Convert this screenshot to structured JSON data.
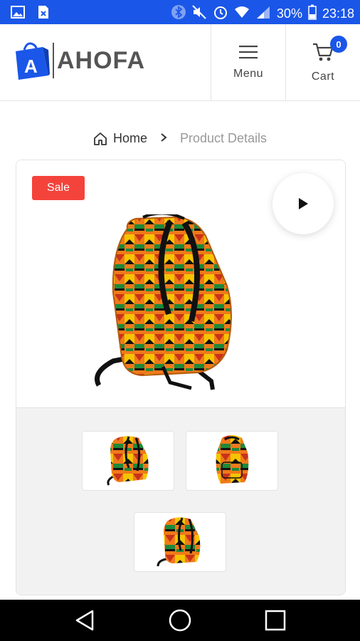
{
  "status_bar": {
    "battery": "30%",
    "time": "23:18",
    "icons": [
      "image-icon",
      "document-icon",
      "bluetooth-icon",
      "mute-icon",
      "alarm-icon",
      "wifi-icon",
      "signal-icon",
      "battery-icon"
    ]
  },
  "header": {
    "logo_text": "AHOFA",
    "logo_letter": "A",
    "menu_label": "Menu",
    "cart_label": "Cart",
    "cart_count": "0"
  },
  "breadcrumb": {
    "home": "Home",
    "current": "Product Details"
  },
  "product": {
    "badge": "Sale"
  },
  "colors": {
    "primary": "#1a56e8",
    "sale": "#f4433b"
  }
}
